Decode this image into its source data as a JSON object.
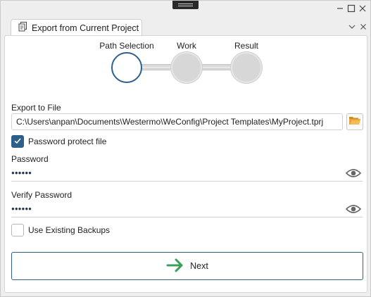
{
  "tab": {
    "title": "Export from Current Project"
  },
  "wizard": {
    "steps": [
      {
        "label": "Path Selection",
        "state": "active"
      },
      {
        "label": "Work",
        "state": "pending"
      },
      {
        "label": "Result",
        "state": "pending"
      }
    ]
  },
  "export_file": {
    "label": "Export to File",
    "value": "C:\\Users\\anpan\\Documents\\Westermo\\WeConfig\\Project Templates\\MyProject.tprj"
  },
  "password_protect": {
    "label": "Password protect file",
    "checked": true
  },
  "password": {
    "label": "Password",
    "value": "●●●●●●"
  },
  "verify_password": {
    "label": "Verify Password",
    "value": "●●●●●●"
  },
  "use_backups": {
    "label": "Use Existing Backups",
    "checked": false
  },
  "next_button": {
    "label": "Next"
  },
  "colors": {
    "accent": "#2d5f8b",
    "next_arrow": "#3aa05a",
    "folder_icon": "#e8a33a"
  },
  "icons": {
    "window": [
      "minimize-icon",
      "maximize-icon",
      "close-icon"
    ],
    "tab": [
      "document-icon",
      "chevron-down-icon",
      "close-icon"
    ],
    "fields": [
      "folder-open-icon",
      "eye-icon",
      "checkmark-icon",
      "arrow-right-icon"
    ]
  }
}
